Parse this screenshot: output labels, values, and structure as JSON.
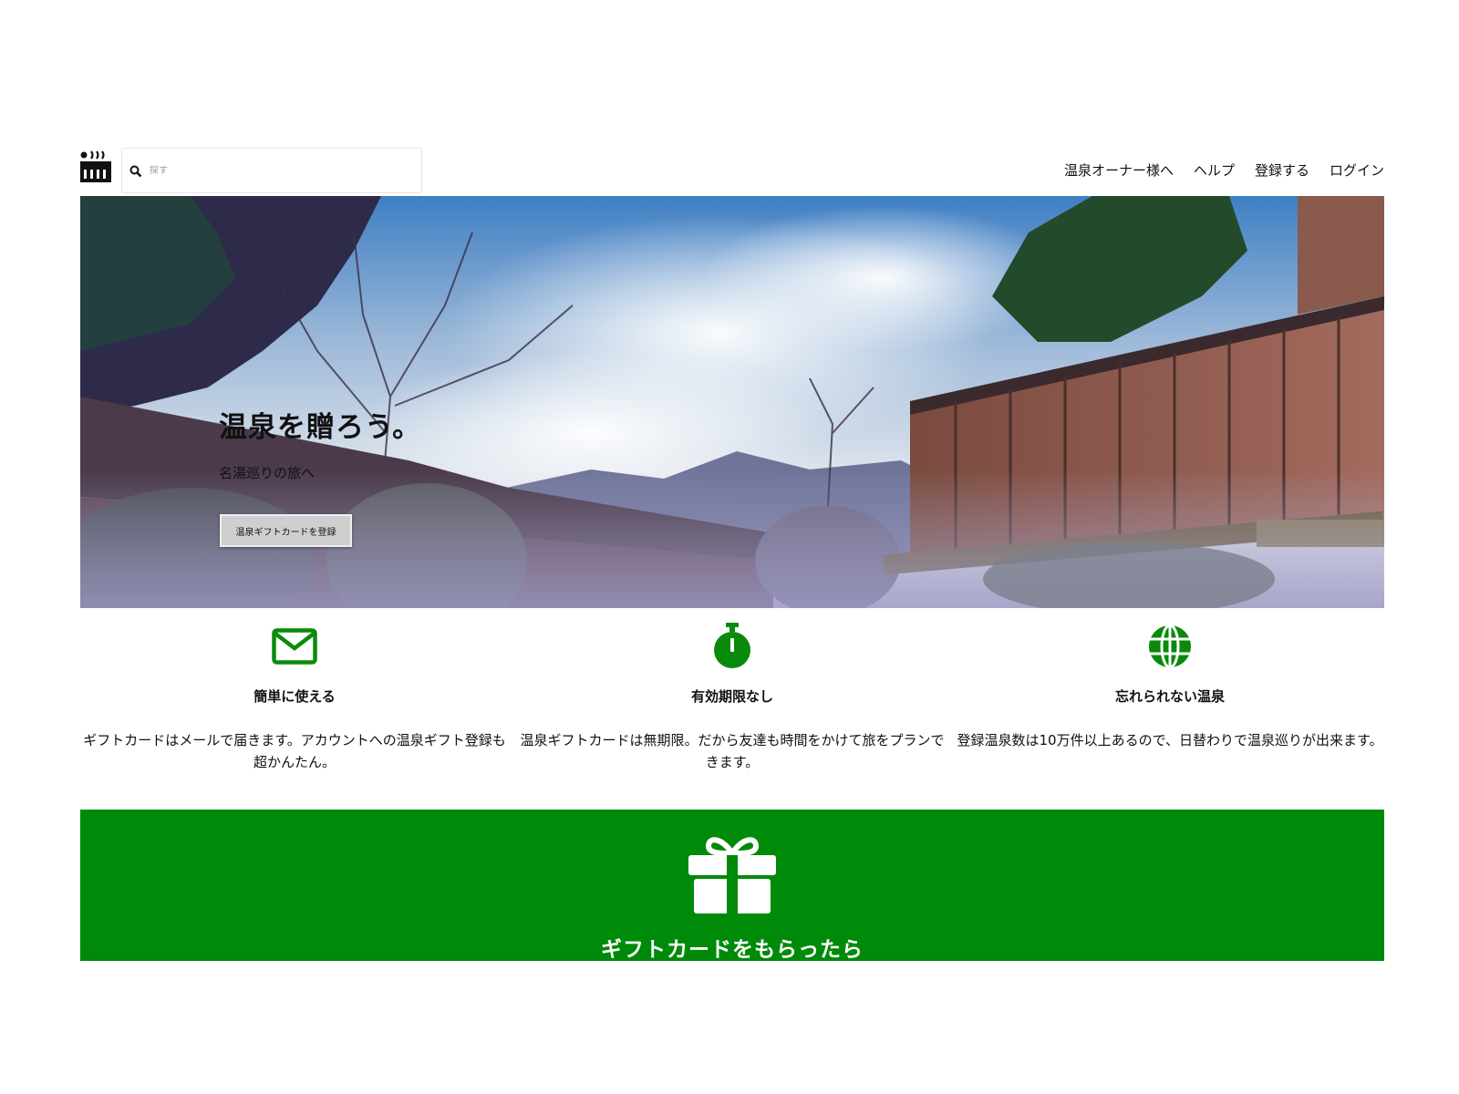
{
  "header": {
    "logo_icon": "onsen-icon",
    "search": {
      "placeholder": "探す",
      "icon": "search-icon"
    },
    "nav": [
      "温泉オーナー様へ",
      "ヘルプ",
      "登録する",
      "ログイン"
    ]
  },
  "hero": {
    "title": "温泉を贈ろう。",
    "subtitle": "名湯巡りの旅へ",
    "button_label": "温泉ギフトカードを登録"
  },
  "features": [
    {
      "icon": "envelope-icon",
      "title": "簡単に使える",
      "text": "ギフトカードはメールで届きます。アカウントへの温泉ギフト登録も超かんたん。"
    },
    {
      "icon": "stopwatch-icon",
      "title": "有効期限なし",
      "text": "温泉ギフトカードは無期限。だから友達も時間をかけて旅をプランできます。"
    },
    {
      "icon": "globe-icon",
      "title": "忘れられない温泉",
      "text": "登録温泉数は10万件以上あるので、日替わりで温泉巡りが出来ます。"
    }
  ],
  "band": {
    "icon": "gift-icon",
    "title": "ギフトカードをもらったら"
  },
  "colors": {
    "accent": "#008a0a",
    "icon_green": "#0a8a0a",
    "text": "#111111"
  }
}
